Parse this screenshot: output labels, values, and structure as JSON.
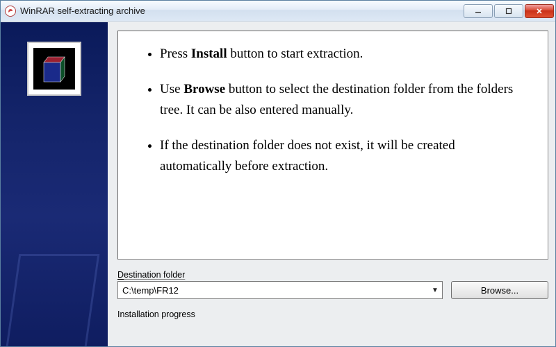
{
  "window": {
    "title": "WinRAR self-extracting archive"
  },
  "instructions": {
    "item1_pre": "Press ",
    "item1_bold": "Install",
    "item1_post": " button to start extraction.",
    "item2_pre": "Use ",
    "item2_bold": "Browse",
    "item2_post": " button to select the destination folder from the folders tree. It can be also entered manually.",
    "item3": "If the destination folder does not exist, it will be created automatically before extraction."
  },
  "destination": {
    "label_pre": "D",
    "label_post": "estination folder",
    "value": "C:\\temp\\FR12",
    "browse_label": "Browse..."
  },
  "progress": {
    "label": "Installation progress"
  }
}
